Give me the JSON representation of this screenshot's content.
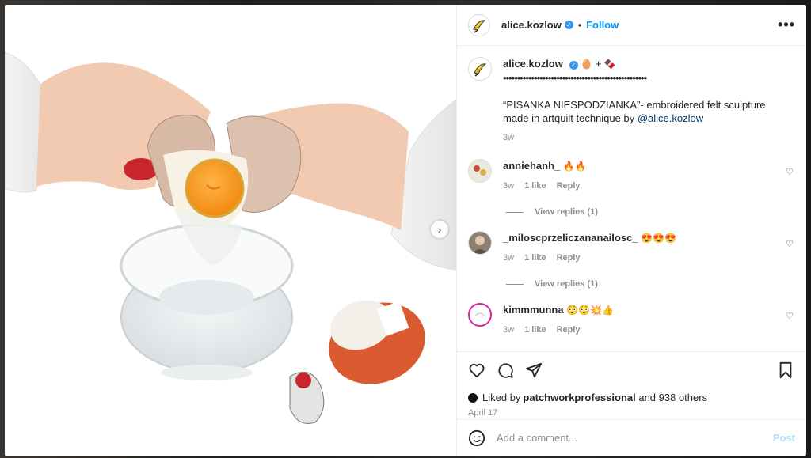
{
  "header": {
    "username": "alice.kozlow",
    "follow_label": "Follow",
    "more_label": "•••"
  },
  "caption": {
    "username": "alice.kozlow",
    "emoji_1": "🥚",
    "plus": "+",
    "emoji_2": "🍫",
    "dots": "•••••••••••••••••••••••••••••••••••••••••••••••••••",
    "text": "“PISANKA NIESPODZIANKA”- embroidered felt sculpture made in artquilt technique by ",
    "mention": "@alice.kozlow",
    "time": "3w"
  },
  "comments": [
    {
      "username": "anniehanh_",
      "text": "🔥🔥",
      "time": "3w",
      "likes": "1 like",
      "reply": "Reply",
      "view_replies": "View replies (1)"
    },
    {
      "username": "_miloscprzeliczananailosc_",
      "text": "😍😍😍",
      "time": "3w",
      "likes": "1 like",
      "reply": "Reply",
      "view_replies": "View replies (1)"
    },
    {
      "username": "kimmmunna",
      "text": "😳😳💥👍",
      "time": "3w",
      "likes": "1 like",
      "reply": "Reply"
    }
  ],
  "likes": {
    "prefix": "Liked by ",
    "user": "patchworkprofessional",
    "suffix": " and 938 others"
  },
  "date": "April 17",
  "add_comment": {
    "placeholder": "Add a comment...",
    "post_label": "Post"
  },
  "icons": {
    "heart": "heart-icon",
    "comment": "comment-icon",
    "share": "share-icon",
    "save": "bookmark-icon",
    "emoji": "emoji-icon",
    "next": "chevron-right-icon"
  },
  "colors": {
    "accent": "#0095f6",
    "verified": "#3897f0",
    "post_disabled": "#b2dffc",
    "mention": "#00376b"
  }
}
